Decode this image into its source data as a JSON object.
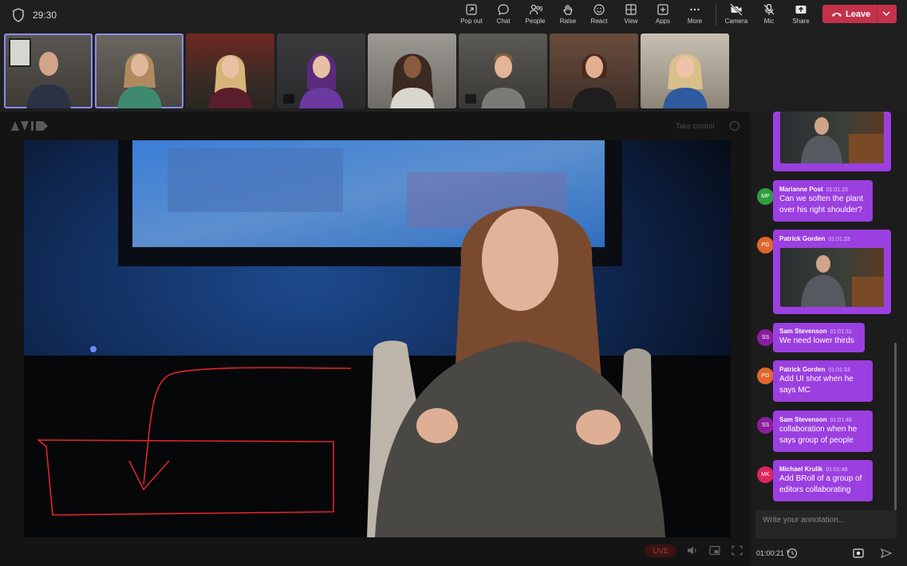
{
  "topbar": {
    "timer": "29:30",
    "buttons": [
      {
        "label": "Pop out",
        "icon": "pop-out-icon"
      },
      {
        "label": "Chat",
        "icon": "chat-icon"
      },
      {
        "label": "People",
        "icon": "people-icon",
        "count": "9"
      },
      {
        "label": "Raise",
        "icon": "raise-hand-icon"
      },
      {
        "label": "React",
        "icon": "react-icon"
      },
      {
        "label": "View",
        "icon": "view-icon"
      },
      {
        "label": "Apps",
        "icon": "apps-icon"
      },
      {
        "label": "More",
        "icon": "more-icon"
      },
      {
        "label": "Camera",
        "icon": "camera-off-icon"
      },
      {
        "label": "Mic",
        "icon": "mic-off-icon"
      },
      {
        "label": "Share",
        "icon": "share-icon"
      }
    ],
    "leave_label": "Leave"
  },
  "stage": {
    "take_control": "Take control",
    "live_label": "LIVE"
  },
  "chat": {
    "messages": [
      {
        "initials": "MP",
        "name": "Marianne Post",
        "time": "01:01:23",
        "text": "Can we soften the plant over his right shoulder?",
        "avatar_color": "#2e9e3e"
      },
      {
        "initials": "PG",
        "name": "Patrick Gorden",
        "time": "01:01:33",
        "text": "",
        "avatar_color": "#e2662c"
      },
      {
        "initials": "SS",
        "name": "Sam Stevenson",
        "time": "01:01:31",
        "text": "We need lower thirds",
        "avatar_color": "#8b1e9e"
      },
      {
        "initials": "PG",
        "name": "Patrick Gorden",
        "time": "01:01:33",
        "text": "Add UI shot when he says MC",
        "avatar_color": "#e2662c"
      },
      {
        "initials": "SS",
        "name": "Sam Stevenson",
        "time": "01:01:48",
        "text": "collaboration when he says group of people",
        "avatar_color": "#8b1e9e"
      },
      {
        "initials": "MK",
        "name": "Michael Krulik",
        "time": "01:01:48",
        "text": "Add BRoll of a group of editors collaborating",
        "avatar_color": "#e0245e"
      }
    ],
    "annotation_placeholder": "Write your annotation...",
    "timecode": "01:00:21"
  },
  "colors": {
    "accent": "#9b3fe0",
    "leave": "#c4314b",
    "selected_tile": "#8b8cf0",
    "annotation_stroke": "#e0242e"
  }
}
